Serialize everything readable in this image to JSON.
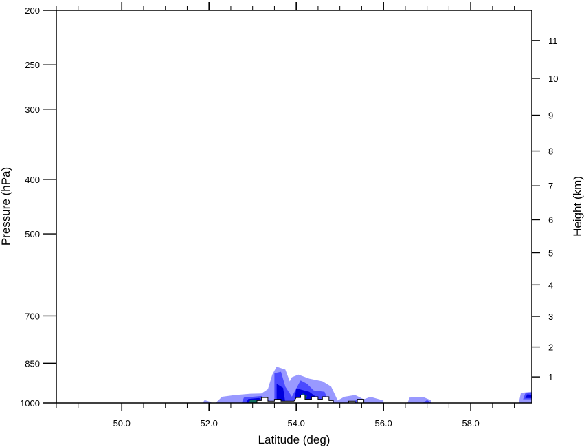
{
  "chart_data": {
    "type": "contour",
    "xlabel": "Latitude (deg)",
    "ylabel": "Pressure (hPa)",
    "ylabel_right": "Height (km)",
    "xlim": [
      48.5,
      59.4
    ],
    "ylim": [
      1000,
      200
    ],
    "y_scale": "log-pressure",
    "x_ticks": [
      50.0,
      52.0,
      54.0,
      56.0,
      58.0
    ],
    "x_tick_labels": [
      "50.0",
      "52.0",
      "54.0",
      "56.0",
      "58.0"
    ],
    "x_minor_step": 0.5,
    "y_ticks": [
      200,
      250,
      300,
      400,
      500,
      700,
      850,
      1000
    ],
    "y_tick_labels": [
      "200",
      "250",
      "300",
      "400",
      "500",
      "700",
      "850",
      "1000"
    ],
    "y_right_ticks": [
      1,
      2,
      3,
      4,
      5,
      6,
      7,
      8,
      9,
      10,
      11
    ],
    "y_right_tick_labels": [
      "1",
      "2",
      "3",
      "4",
      "5",
      "6",
      "7",
      "8",
      "9",
      "10",
      "11"
    ],
    "colors": {
      "level1": "#9999ff",
      "level2": "#4a4aff",
      "level3": "#0000dd",
      "level4": "#107060"
    },
    "filled_regions": [
      {
        "level": 1,
        "points": [
          [
            51.85,
            1000
          ],
          [
            51.9,
            988
          ],
          [
            52.05,
            996
          ],
          [
            52.05,
            1000
          ]
        ]
      },
      {
        "level": 1,
        "points": [
          [
            52.15,
            1000
          ],
          [
            52.3,
            975
          ],
          [
            52.6,
            968
          ],
          [
            52.95,
            963
          ],
          [
            53.2,
            962
          ],
          [
            53.35,
            945
          ],
          [
            53.45,
            890
          ],
          [
            53.55,
            862
          ],
          [
            53.75,
            872
          ],
          [
            53.85,
            915
          ],
          [
            53.9,
            900
          ],
          [
            54.05,
            890
          ],
          [
            54.3,
            905
          ],
          [
            54.6,
            915
          ],
          [
            54.8,
            935
          ],
          [
            54.95,
            990
          ],
          [
            55.1,
            975
          ],
          [
            55.35,
            968
          ],
          [
            55.55,
            985
          ],
          [
            55.7,
            975
          ],
          [
            56.0,
            990
          ],
          [
            56.0,
            1000
          ]
        ]
      },
      {
        "level": 1,
        "points": [
          [
            56.55,
            1000
          ],
          [
            56.6,
            978
          ],
          [
            56.9,
            975
          ],
          [
            57.1,
            990
          ],
          [
            57.1,
            1000
          ]
        ]
      },
      {
        "level": 1,
        "points": [
          [
            59.1,
            1000
          ],
          [
            59.15,
            960
          ],
          [
            59.4,
            955
          ],
          [
            59.4,
            1000
          ]
        ]
      },
      {
        "level": 2,
        "points": [
          [
            52.75,
            1000
          ],
          [
            52.8,
            978
          ],
          [
            53.2,
            972
          ],
          [
            53.35,
            985
          ],
          [
            53.45,
            1000
          ]
        ]
      },
      {
        "level": 2,
        "points": [
          [
            53.5,
            1000
          ],
          [
            53.5,
            885
          ],
          [
            53.65,
            880
          ],
          [
            53.75,
            935
          ],
          [
            53.9,
            975
          ],
          [
            54.1,
            912
          ],
          [
            54.25,
            925
          ],
          [
            54.4,
            950
          ],
          [
            54.65,
            955
          ],
          [
            54.75,
            1000
          ]
        ]
      },
      {
        "level": 2,
        "points": [
          [
            55.3,
            1000
          ],
          [
            55.4,
            983
          ],
          [
            55.55,
            1000
          ]
        ]
      },
      {
        "level": 2,
        "points": [
          [
            56.9,
            1000
          ],
          [
            57.0,
            988
          ],
          [
            57.1,
            1000
          ]
        ]
      },
      {
        "level": 2,
        "points": [
          [
            59.2,
            985
          ],
          [
            59.25,
            962
          ],
          [
            59.4,
            960
          ],
          [
            59.4,
            985
          ]
        ]
      },
      {
        "level": 3,
        "points": [
          [
            52.85,
            1000
          ],
          [
            52.9,
            984
          ],
          [
            53.15,
            980
          ],
          [
            53.3,
            1000
          ]
        ]
      },
      {
        "level": 3,
        "points": [
          [
            53.55,
            1000
          ],
          [
            53.55,
            925
          ],
          [
            53.7,
            940
          ],
          [
            53.75,
            1000
          ]
        ]
      },
      {
        "level": 3,
        "points": [
          [
            53.95,
            1000
          ],
          [
            54.0,
            942
          ],
          [
            54.3,
            955
          ],
          [
            54.45,
            975
          ],
          [
            54.5,
            1000
          ]
        ]
      },
      {
        "level": 3,
        "points": [
          [
            59.25,
            980
          ],
          [
            59.3,
            965
          ],
          [
            59.4,
            968
          ],
          [
            59.4,
            980
          ]
        ]
      },
      {
        "level": 4,
        "points": [
          [
            52.9,
            1000
          ],
          [
            52.95,
            988
          ],
          [
            53.1,
            988
          ],
          [
            53.12,
            1000
          ]
        ]
      },
      {
        "level": 4,
        "points": [
          [
            54.1,
            985
          ],
          [
            54.15,
            962
          ],
          [
            54.25,
            972
          ],
          [
            54.2,
            990
          ]
        ]
      }
    ],
    "terrain_outline": [
      [
        53.1,
        1000
      ],
      [
        53.1,
        990
      ],
      [
        53.2,
        990
      ],
      [
        53.2,
        978
      ],
      [
        53.35,
        978
      ],
      [
        53.35,
        992
      ],
      [
        53.5,
        992
      ],
      [
        53.5,
        985
      ],
      [
        53.65,
        985
      ],
      [
        53.65,
        992
      ],
      [
        53.95,
        992
      ],
      [
        54.0,
        978
      ],
      [
        54.1,
        978
      ],
      [
        54.1,
        968
      ],
      [
        54.2,
        968
      ],
      [
        54.2,
        985
      ],
      [
        54.35,
        985
      ],
      [
        54.35,
        975
      ],
      [
        54.5,
        975
      ],
      [
        54.5,
        985
      ],
      [
        54.6,
        985
      ],
      [
        54.6,
        975
      ],
      [
        54.75,
        975
      ],
      [
        54.75,
        990
      ],
      [
        54.85,
        990
      ],
      [
        54.85,
        1000
      ],
      [
        55.2,
        1000
      ],
      [
        55.2,
        992
      ],
      [
        55.35,
        992
      ],
      [
        55.35,
        1000
      ],
      [
        55.4,
        1000
      ],
      [
        55.4,
        985
      ],
      [
        55.55,
        985
      ],
      [
        55.55,
        1000
      ]
    ]
  }
}
